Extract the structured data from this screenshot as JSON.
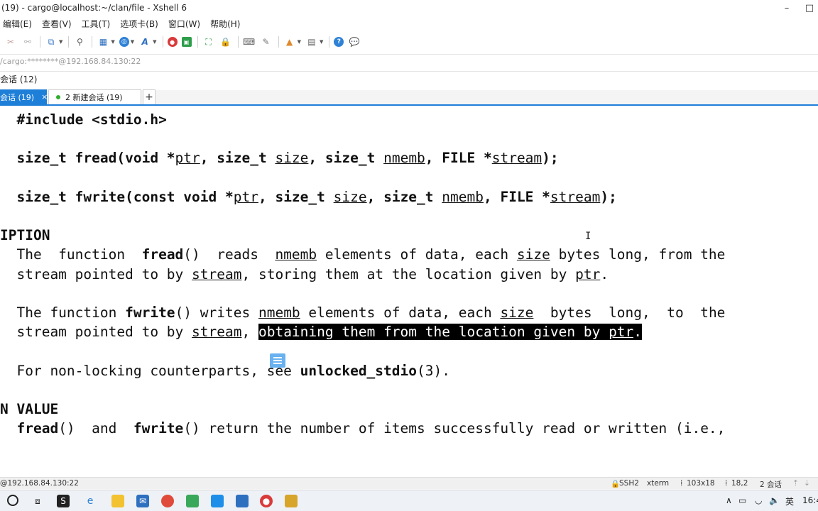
{
  "window": {
    "title": "(19) - cargo@localhost:~/clan/file - Xshell 6",
    "minimize_glyph": "–",
    "maximize_glyph": "□"
  },
  "menu": [
    "编辑(E)",
    "查看(V)",
    "工具(T)",
    "选项卡(B)",
    "窗口(W)",
    "帮助(H)"
  ],
  "address": "/cargo:********@192.168.84.130:22",
  "session_manager": {
    "label": "会话 (12)"
  },
  "tabs": {
    "active_label": "会话 (19)",
    "close_glyph": "×",
    "second_label": "2 新建会话 (19)",
    "add_glyph": "+"
  },
  "terminal": {
    "lines": [
      [
        {
          "t": "  "
        },
        {
          "t": "#include <stdio.h>",
          "b": true
        }
      ],
      [],
      [
        {
          "t": "  "
        },
        {
          "t": "size_t fread(void *",
          "b": true
        },
        {
          "t": "ptr",
          "u": true
        },
        {
          "t": ", size_t ",
          "b": true
        },
        {
          "t": "size",
          "u": true
        },
        {
          "t": ", size_t ",
          "b": true
        },
        {
          "t": "nmemb",
          "u": true
        },
        {
          "t": ", FILE *",
          "b": true
        },
        {
          "t": "stream",
          "u": true
        },
        {
          "t": ");",
          "b": true
        }
      ],
      [],
      [
        {
          "t": "  "
        },
        {
          "t": "size_t fwrite(const void *",
          "b": true
        },
        {
          "t": "ptr",
          "u": true
        },
        {
          "t": ", size_t ",
          "b": true
        },
        {
          "t": "size",
          "u": true
        },
        {
          "t": ", size_t ",
          "b": true
        },
        {
          "t": "nmemb",
          "u": true
        },
        {
          "t": ", FILE *",
          "b": true
        },
        {
          "t": "stream",
          "u": true
        },
        {
          "t": ");",
          "b": true
        }
      ],
      [],
      [
        {
          "t": "IPTION",
          "b": true
        }
      ],
      [
        {
          "t": "  The  function  "
        },
        {
          "t": "fread",
          "b": true
        },
        {
          "t": "()  reads  "
        },
        {
          "t": "nmemb",
          "u": true
        },
        {
          "t": " elements of data, each "
        },
        {
          "t": "size",
          "u": true
        },
        {
          "t": " bytes long, from the"
        }
      ],
      [
        {
          "t": "  stream pointed to by "
        },
        {
          "t": "stream",
          "u": true
        },
        {
          "t": ", storing them at the location given by "
        },
        {
          "t": "ptr",
          "u": true
        },
        {
          "t": "."
        }
      ],
      [],
      [
        {
          "t": "  The function "
        },
        {
          "t": "fwrite",
          "b": true
        },
        {
          "t": "() writes "
        },
        {
          "t": "nmemb",
          "u": true
        },
        {
          "t": " elements of data, each "
        },
        {
          "t": "size",
          "u": true
        },
        {
          "t": "  bytes  long,  to  the"
        }
      ],
      [
        {
          "t": "  stream pointed to by "
        },
        {
          "t": "stream",
          "u": true
        },
        {
          "t": ", "
        },
        {
          "t": "obtaining them from the location given by ",
          "hl": true
        },
        {
          "t": "ptr",
          "u": true,
          "hl": true
        },
        {
          "t": ".",
          "hl": true
        }
      ],
      [],
      [
        {
          "t": "  For non-locking counterparts, see "
        },
        {
          "t": "unlocked_stdio",
          "b": true
        },
        {
          "t": "(3)."
        }
      ],
      [],
      [
        {
          "t": "N VALUE",
          "b": true
        }
      ],
      [
        {
          "t": "  "
        },
        {
          "t": "fread",
          "b": true
        },
        {
          "t": "()  and  "
        },
        {
          "t": "fwrite",
          "b": true
        },
        {
          "t": "() return the number of items successfully read or written (i.e.,"
        }
      ]
    ],
    "mouse_cursor_glyph": "I"
  },
  "status": {
    "host": "@192.168.84.130:22",
    "protocol": "SSH2",
    "term": "xterm",
    "size": "103x18",
    "position": "18,2",
    "sessions": "2 会话",
    "up_glyph": "⇡",
    "down_glyph": "⇣"
  },
  "taskbar": {
    "tray_lang": "英",
    "tray_time": "16:4",
    "tray_caret": "∧"
  },
  "colors": {
    "accent": "#1e7fd8",
    "session_dot": "#2eae2e",
    "highlight_bg": "#000000",
    "highlight_fg": "#ffffff"
  }
}
